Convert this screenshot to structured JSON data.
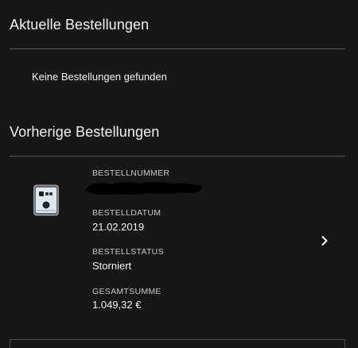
{
  "current_orders": {
    "title": "Aktuelle Bestellungen",
    "empty_message": "Keine Bestellungen gefunden"
  },
  "previous_orders": {
    "title": "Vorherige Bestellungen",
    "orders": [
      {
        "order_number_label": "BESTELLNUMMER",
        "order_date_label": "BESTELLDATUM",
        "order_date": "21.02.2019",
        "order_status_label": "BESTELLSTATUS",
        "order_status": "Storniert",
        "total_label": "GESAMTSUMME",
        "total": "1.049,32 €",
        "thumbnail_icon": "smartphone-icon",
        "chevron_icon": "chevron-right-icon"
      }
    ]
  },
  "colors": {
    "background": "#171717",
    "divider": "#5a5a5a",
    "text": "#f2f2f2",
    "label": "#c8c8c8"
  }
}
